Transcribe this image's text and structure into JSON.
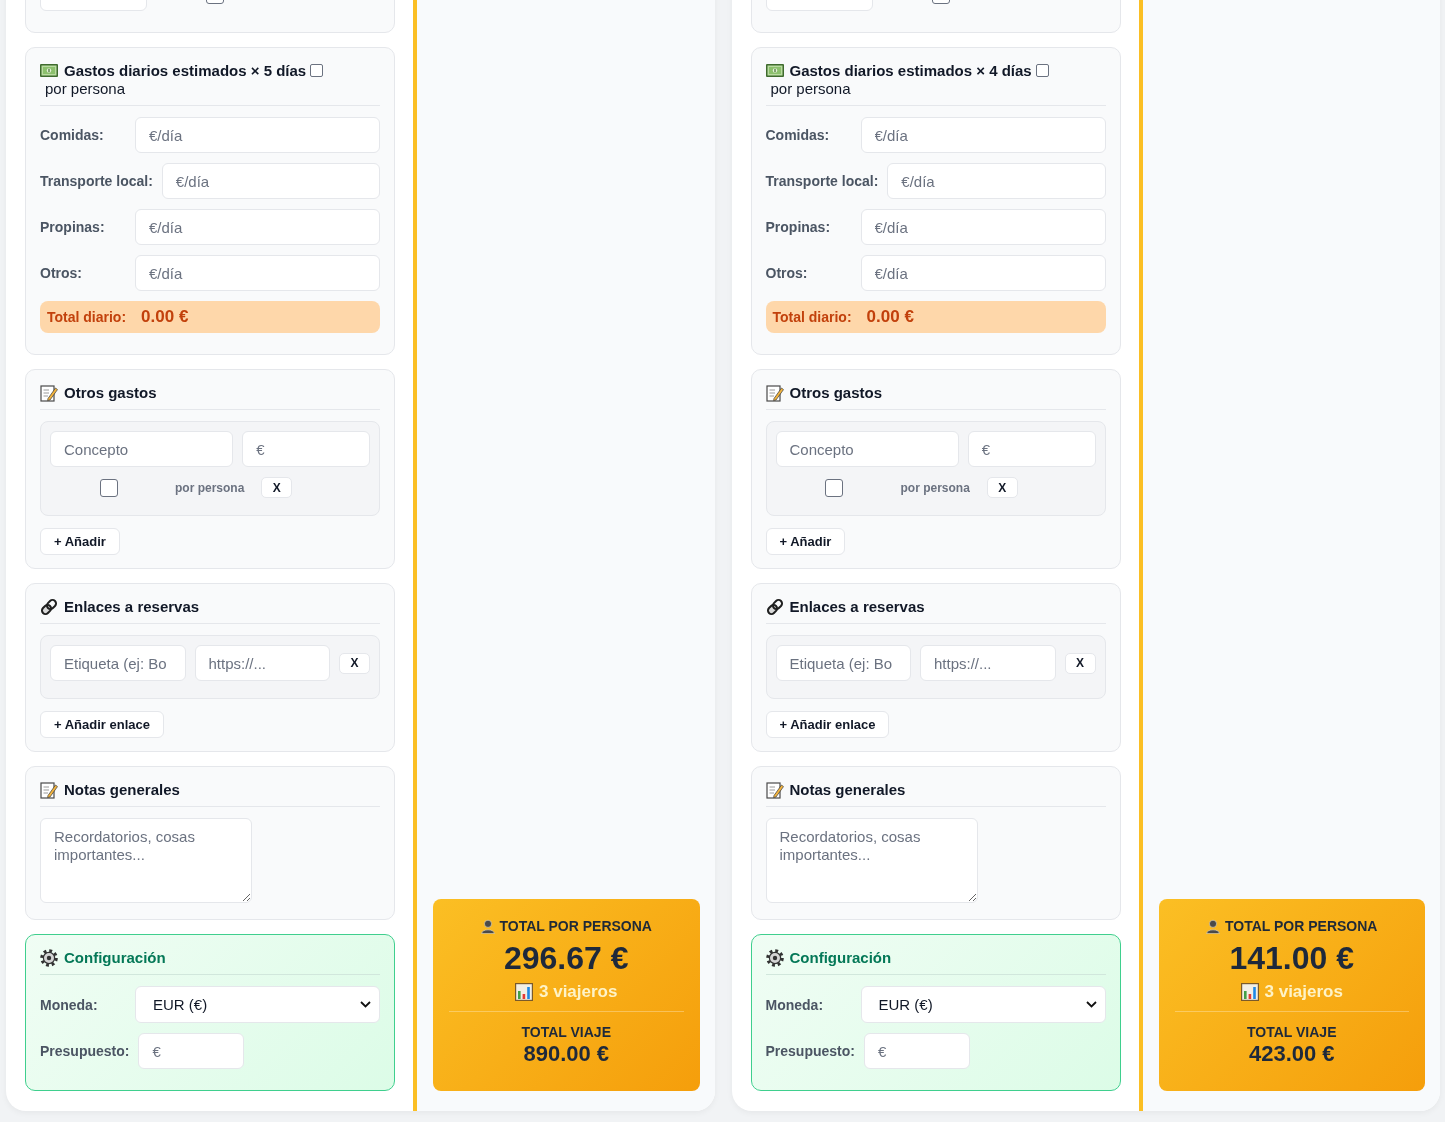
{
  "planners": [
    {
      "partial_card": {
        "checkbox": {
          "checked": false
        }
      },
      "daily_expenses": {
        "title": "Gastos diarios estimados × 5 días",
        "per_person": {
          "label": "por persona",
          "checked": false
        },
        "rows": [
          {
            "label": "Comidas:",
            "placeholder": "€/día"
          },
          {
            "label": "Transporte local:",
            "placeholder": "€/día"
          },
          {
            "label": "Propinas:",
            "placeholder": "€/día"
          },
          {
            "label": "Otros:",
            "placeholder": "€/día"
          }
        ],
        "total_label": "Total diario:",
        "total_value": "0.00 €"
      },
      "other_expenses": {
        "title": "Otros gastos",
        "items": [
          {
            "concept_placeholder": "Concepto",
            "amount_placeholder": "€",
            "per_person": {
              "label": "por persona",
              "checked": false
            },
            "remove_button": "X"
          }
        ],
        "add_button": "+ Añadir"
      },
      "booking_links": {
        "title": "Enlaces a reservas",
        "items": [
          {
            "label_placeholder": "Etiqueta (ej: Bo",
            "url_placeholder": "https://...",
            "remove_button": "X"
          }
        ],
        "add_button": "+ Añadir enlace"
      },
      "notes": {
        "title": "Notas generales",
        "placeholder": "Recordatorios, cosas importantes..."
      },
      "settings": {
        "title": "Configuración",
        "fields": [
          {
            "kind": "select",
            "label": "Moneda:",
            "value": "EUR (€)"
          },
          {
            "kind": "input",
            "label": "Presupuesto:",
            "placeholder": "€"
          }
        ]
      },
      "summary": {
        "per_person_label": "TOTAL POR PERSONA",
        "per_person_total": "296.67 €",
        "travelers": "3 viajeros",
        "trip_label": "TOTAL VIAJE",
        "trip_total": "890.00 €"
      }
    },
    {
      "partial_card": {
        "checkbox": {
          "checked": false
        }
      },
      "daily_expenses": {
        "title": "Gastos diarios estimados × 4 días",
        "per_person": {
          "label": "por persona",
          "checked": false
        },
        "rows": [
          {
            "label": "Comidas:",
            "placeholder": "€/día"
          },
          {
            "label": "Transporte local:",
            "placeholder": "€/día"
          },
          {
            "label": "Propinas:",
            "placeholder": "€/día"
          },
          {
            "label": "Otros:",
            "placeholder": "€/día"
          }
        ],
        "total_label": "Total diario:",
        "total_value": "0.00 €"
      },
      "other_expenses": {
        "title": "Otros gastos",
        "items": [
          {
            "concept_placeholder": "Concepto",
            "amount_placeholder": "€",
            "per_person": {
              "label": "por persona",
              "checked": false
            },
            "remove_button": "X"
          }
        ],
        "add_button": "+ Añadir"
      },
      "booking_links": {
        "title": "Enlaces a reservas",
        "items": [
          {
            "label_placeholder": "Etiqueta (ej: Bo",
            "url_placeholder": "https://...",
            "remove_button": "X"
          }
        ],
        "add_button": "+ Añadir enlace"
      },
      "notes": {
        "title": "Notas generales",
        "placeholder": "Recordatorios, cosas importantes..."
      },
      "settings": {
        "title": "Configuración",
        "fields": [
          {
            "kind": "select",
            "label": "Moneda:",
            "value": "EUR (€)"
          },
          {
            "kind": "input",
            "label": "Presupuesto:",
            "placeholder": "€"
          }
        ]
      },
      "summary": {
        "per_person_label": "TOTAL POR PERSONA",
        "per_person_total": "141.00 €",
        "travelers": "3 viajeros",
        "trip_label": "TOTAL VIAJE",
        "trip_total": "423.00 €"
      }
    }
  ]
}
